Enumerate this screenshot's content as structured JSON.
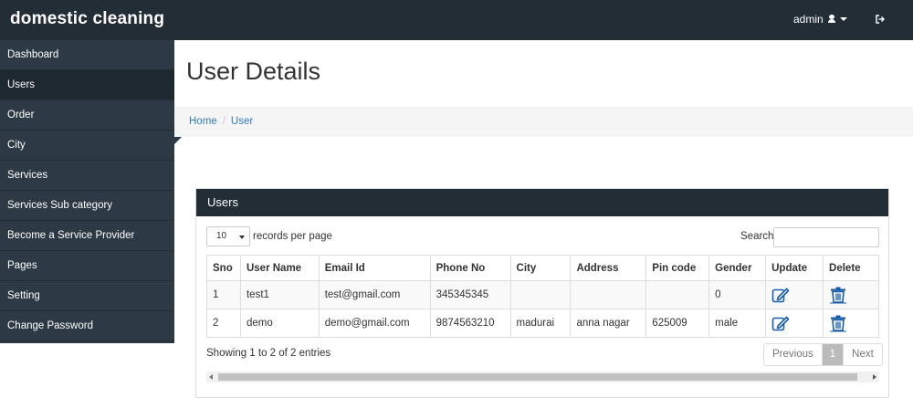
{
  "app": {
    "brand": "domestic cleaning"
  },
  "header": {
    "user_label": "admin",
    "user_icon": "user-icon",
    "logout_icon": "sign-out-icon"
  },
  "sidebar": {
    "items": [
      {
        "label": "Dashboard"
      },
      {
        "label": "Users",
        "active": true
      },
      {
        "label": "Order"
      },
      {
        "label": "City"
      },
      {
        "label": "Services"
      },
      {
        "label": "Services Sub category"
      },
      {
        "label": "Become a Service Provider"
      },
      {
        "label": "Pages"
      },
      {
        "label": "Setting"
      },
      {
        "label": "Change Password"
      }
    ]
  },
  "page": {
    "title": "User Details"
  },
  "breadcrumb": {
    "home": "Home",
    "separator": "/",
    "current": "User"
  },
  "panel": {
    "title": "Users",
    "length_value": "10",
    "length_label": "records per page",
    "search_label": "Search:",
    "search_value": "",
    "columns": [
      "Sno",
      "User Name",
      "Email Id",
      "Phone No",
      "City",
      "Address",
      "Pin code",
      "Gender",
      "Update",
      "Delete"
    ],
    "rows": [
      {
        "sno": "1",
        "user_name": "test1",
        "email": "test@gmail.com",
        "phone": "345345345",
        "city": "",
        "address": "",
        "pin_code": "",
        "gender": "0"
      },
      {
        "sno": "2",
        "user_name": "demo",
        "email": "demo@gmail.com",
        "phone": "9874563210",
        "city": "madurai",
        "address": "anna nagar",
        "pin_code": "625009",
        "gender": "male"
      }
    ],
    "update_icon": "edit-icon",
    "delete_icon": "trash-icon",
    "info": "Showing 1 to 2 of 2 entries",
    "pagination": {
      "previous": "Previous",
      "current": "1",
      "next": "Next"
    }
  },
  "colors": {
    "navbar": "#222d35",
    "sidebar": "#2d3a45",
    "link": "#337ab7",
    "icon_blue": "#1a5da8"
  }
}
